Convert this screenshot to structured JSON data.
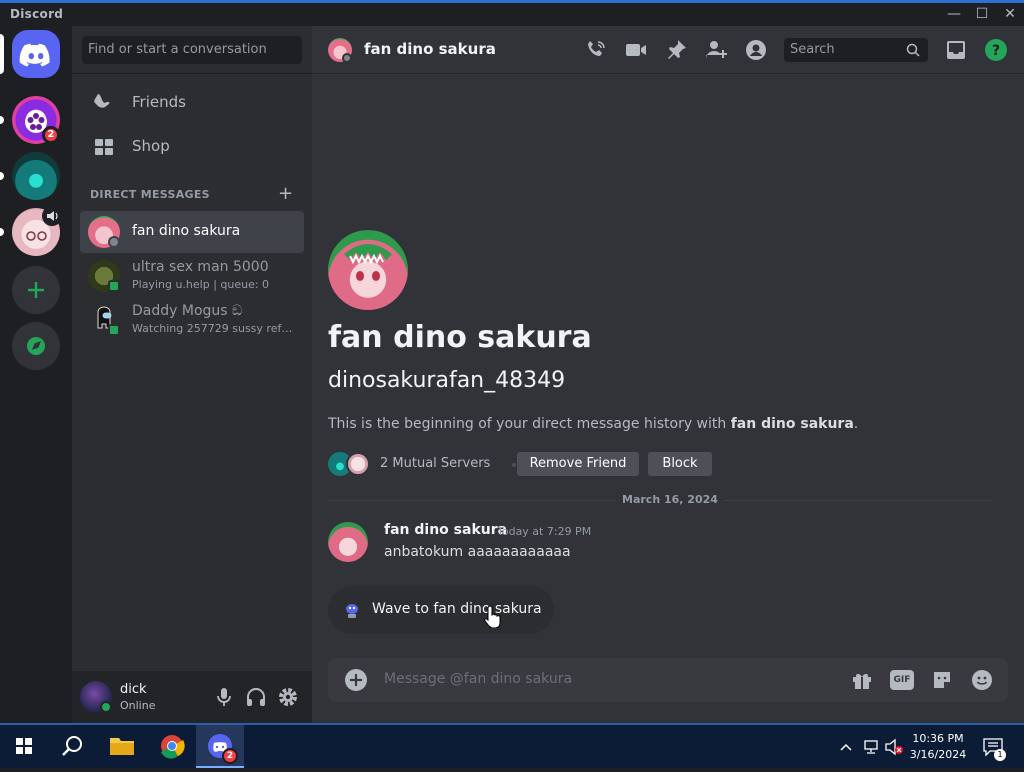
{
  "window": {
    "title": "Discord",
    "controls": [
      "—",
      "☐",
      "✕"
    ]
  },
  "servers": [
    {
      "name": "server-1",
      "badge": "2"
    },
    {
      "name": "server-2"
    },
    {
      "name": "server-3"
    }
  ],
  "sidebar": {
    "search_placeholder": "Find or start a conversation",
    "nav": [
      {
        "label": "Friends"
      },
      {
        "label": "Shop"
      }
    ],
    "dm_header": "DIRECT MESSAGES",
    "dm_add": "+",
    "dms": [
      {
        "name": "fan dino sakura",
        "sub": ""
      },
      {
        "name": "ultra sex man 5000",
        "sub": "Playing u.help | queue: 0"
      },
      {
        "name": "Daddy Mogus ඞ",
        "sub": "Watching 257729 sussy referees"
      }
    ]
  },
  "user_panel": {
    "username": "dick",
    "status": "Online"
  },
  "header": {
    "channel_name": "fan dino sakura",
    "search_placeholder": "Search"
  },
  "profile": {
    "display_name": "fan dino sakura",
    "username": "dinosakurafan_48349",
    "intro_prefix": "This is the beginning of your direct message history with ",
    "intro_name": "fan dino sakura",
    "intro_suffix": ".",
    "mutual_servers": "2 Mutual Servers",
    "remove_friend": "Remove Friend",
    "block": "Block"
  },
  "messages": {
    "date_divider": "March 16, 2024",
    "items": [
      {
        "author": "fan dino sakura",
        "time": "Today at 7:29 PM",
        "text": "anbatokum aaaaaaaaaaaa"
      }
    ]
  },
  "wave_button": "Wave to fan dino sakura",
  "composer": {
    "placeholder": "Message @fan dino sakura",
    "gif_label": "GIF"
  },
  "taskbar": {
    "time": "10:36 PM",
    "date": "3/16/2024",
    "discord_badge": "2",
    "notif_count": "1"
  },
  "colors": {
    "accent": "#5865f2",
    "online": "#23a55a",
    "danger": "#f23f43",
    "help": "#23a55a"
  }
}
